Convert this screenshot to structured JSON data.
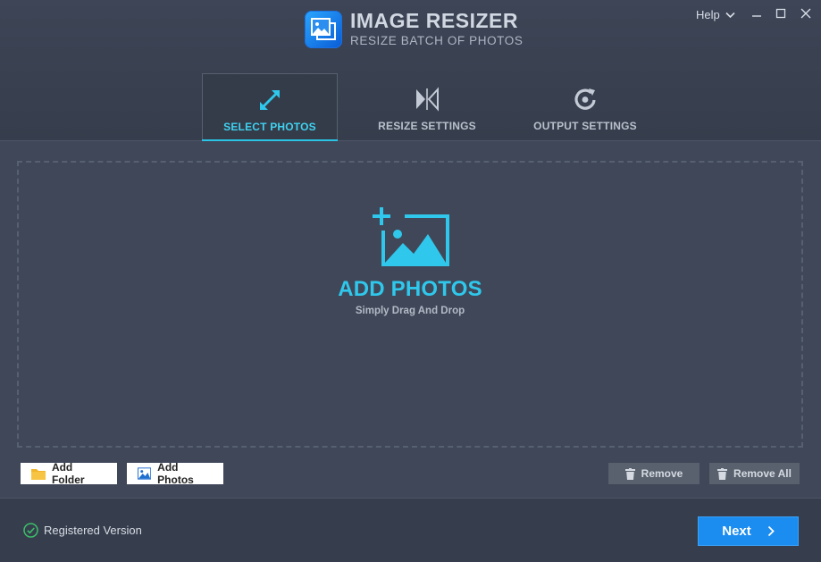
{
  "header": {
    "title": "IMAGE RESIZER",
    "subtitle": "RESIZE BATCH OF PHOTOS",
    "help_label": "Help"
  },
  "tabs": [
    {
      "label": "SELECT PHOTOS",
      "icon": "expand-arrows-icon",
      "active": true
    },
    {
      "label": "RESIZE SETTINGS",
      "icon": "resize-bowtie-icon",
      "active": false
    },
    {
      "label": "OUTPUT SETTINGS",
      "icon": "refresh-gear-icon",
      "active": false
    }
  ],
  "drop_zone": {
    "title": "ADD PHOTOS",
    "subtitle": "Simply Drag And Drop"
  },
  "actions": {
    "add_folder": "Add Folder",
    "add_photos": "Add Photos",
    "remove": "Remove",
    "remove_all": "Remove All"
  },
  "footer": {
    "status": "Registered Version",
    "next": "Next"
  },
  "colors": {
    "accent": "#2fc8ec",
    "primary_button": "#1c8df0",
    "background": "#3f4758",
    "status_ok": "#3bbf6a"
  }
}
